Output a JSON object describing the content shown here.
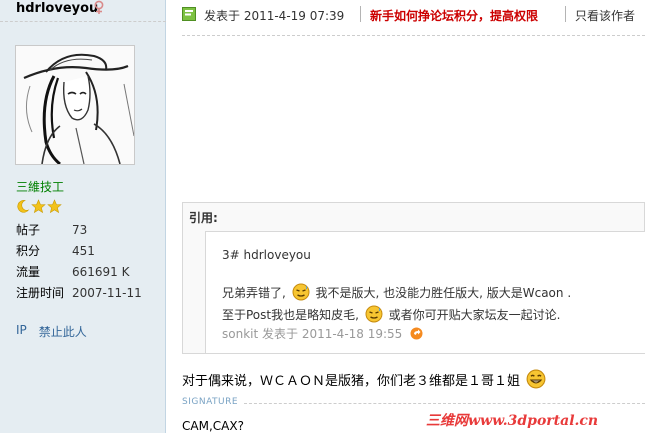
{
  "user": {
    "username": "hdrloveyou",
    "group": "三維技工",
    "stats": [
      {
        "label": "帖子",
        "value": "73"
      },
      {
        "label": "积分",
        "value": "451"
      },
      {
        "label": "流量",
        "value": "661691 K"
      },
      {
        "label": "注册时间",
        "value": "2007-11-11"
      }
    ],
    "actions": {
      "ip": "IP",
      "ban": "禁止此人"
    }
  },
  "post": {
    "time_label": "发表于  2011-4-19 07:39",
    "newbie_link": "新手如何挣论坛积分，提高权限",
    "author_only": "只看该作者",
    "quote": {
      "title": "引用:",
      "head": "3# hdrloveyou",
      "line1_a": "兄弟弄错了,",
      "line1_b": "我不是版大, 也没能力胜任版大, 版大是Wcaon .",
      "line2_a": "至于Post我也是略知皮毛,",
      "line2_b": "或者你可开贴大家坛友一起讨论.",
      "signature": "sonkit 发表于  2011-4-18 19:55"
    },
    "body": "对于偶来说，ＷＣＡＯＮ是版猪，你们老３维都是１哥１姐",
    "signature_label": "SIGNATURE",
    "signature_text": "CAM,CAX?"
  },
  "watermark": "三维网www.3dportal.cn"
}
